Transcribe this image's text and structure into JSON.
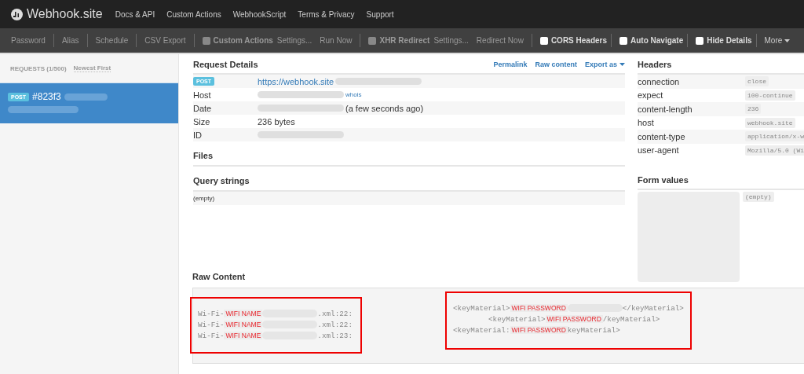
{
  "navbar": {
    "brand": "Webhook.site",
    "links": [
      "Docs & API",
      "Custom Actions",
      "WebhookScript",
      "Terms & Privacy",
      "Support"
    ]
  },
  "toolbar": [
    {
      "kind": "link",
      "label": "Password"
    },
    {
      "kind": "sep"
    },
    {
      "kind": "link",
      "label": "Alias"
    },
    {
      "kind": "sep"
    },
    {
      "kind": "link",
      "label": "Schedule"
    },
    {
      "kind": "sep"
    },
    {
      "kind": "link",
      "label": "CSV Export"
    },
    {
      "kind": "sep"
    },
    {
      "kind": "check",
      "label": "Custom Actions",
      "checked": false,
      "disabled": true
    },
    {
      "kind": "link",
      "label": "Settings..."
    },
    {
      "kind": "link",
      "label": "Run Now"
    },
    {
      "kind": "sep"
    },
    {
      "kind": "check",
      "label": "XHR Redirect",
      "checked": false,
      "disabled": true
    },
    {
      "kind": "link",
      "label": "Settings..."
    },
    {
      "kind": "link",
      "label": "Redirect Now"
    },
    {
      "kind": "sep"
    },
    {
      "kind": "check",
      "label": "CORS Headers",
      "checked": false,
      "disabled": false
    },
    {
      "kind": "sep"
    },
    {
      "kind": "check",
      "label": "Auto Navigate",
      "checked": false,
      "disabled": false
    },
    {
      "kind": "sep"
    },
    {
      "kind": "check",
      "label": "Hide Details",
      "checked": false,
      "disabled": false
    },
    {
      "kind": "sep"
    },
    {
      "kind": "dropdown",
      "label": "More"
    }
  ],
  "sidebar": {
    "title": "REQUESTS (1/500)",
    "sort": "Newest First",
    "requests": [
      {
        "method": "POST",
        "id": "#823f3",
        "selected": true
      }
    ]
  },
  "request_details": {
    "title": "Request Details",
    "actions": [
      {
        "label": "Permalink",
        "kind": "link"
      },
      {
        "label": "Raw content",
        "kind": "link"
      },
      {
        "label": "Export as",
        "kind": "dropdown"
      }
    ],
    "rows": [
      {
        "parts": [
          {
            "kind": "badge",
            "text": "POST"
          }
        ],
        "value": [
          {
            "kind": "link",
            "text": "https://webhook.site"
          },
          {
            "kind": "blur"
          }
        ]
      },
      {
        "parts": [
          {
            "kind": "text",
            "text": "Host"
          }
        ],
        "value": [
          {
            "kind": "blur"
          },
          {
            "kind": "small-link",
            "text": "whois"
          }
        ]
      },
      {
        "parts": [
          {
            "kind": "text",
            "text": "Date"
          }
        ],
        "value": [
          {
            "kind": "blur"
          },
          {
            "kind": "text",
            "text": "(a few seconds ago)"
          }
        ]
      },
      {
        "parts": [
          {
            "kind": "text",
            "text": "Size"
          }
        ],
        "value": [
          {
            "kind": "text",
            "text": "236 bytes"
          }
        ]
      },
      {
        "parts": [
          {
            "kind": "text",
            "text": "ID"
          }
        ],
        "value": [
          {
            "kind": "blur"
          }
        ]
      }
    ]
  },
  "files": {
    "title": "Files"
  },
  "query_strings": {
    "title": "Query strings",
    "value": "(empty)"
  },
  "headers": {
    "title": "Headers",
    "rows": [
      {
        "name": "connection",
        "value": "close"
      },
      {
        "name": "expect",
        "value": "100-continue"
      },
      {
        "name": "content-length",
        "value": "236"
      },
      {
        "name": "host",
        "value": "webhook.site"
      },
      {
        "name": "content-type",
        "value": "application/x-w"
      },
      {
        "name": "user-agent",
        "value": "Mozilla/5.0 (Wi"
      }
    ]
  },
  "form_values": {
    "title": "Form values",
    "value": "(empty)"
  },
  "raw_content": {
    "title": "Raw Content",
    "blocks": [
      {
        "lines": [
          [
            {
              "kind": "text",
              "text": "Wi-Fi-"
            },
            {
              "kind": "label",
              "text": "WIFI NAME"
            },
            {
              "kind": "blur"
            },
            {
              "kind": "text",
              "text": ".xml:22:"
            }
          ],
          [
            {
              "kind": "text",
              "text": "Wi-Fi-"
            },
            {
              "kind": "label",
              "text": "WIFI NAME"
            },
            {
              "kind": "blur"
            },
            {
              "kind": "text",
              "text": ".xml:22:"
            }
          ],
          [
            {
              "kind": "text",
              "text": "Wi-Fi-"
            },
            {
              "kind": "label",
              "text": "WIFI NAME"
            },
            {
              "kind": "blur"
            },
            {
              "kind": "text",
              "text": ".xml:23:"
            }
          ]
        ]
      },
      {
        "lines": [
          [
            {
              "kind": "text",
              "text": "<keyMaterial>"
            },
            {
              "kind": "label",
              "text": "WIFI PASSWORD"
            },
            {
              "kind": "blur"
            },
            {
              "kind": "text",
              "text": "</keyMaterial>"
            }
          ],
          [
            {
              "kind": "indent"
            },
            {
              "kind": "text",
              "text": "<keyMaterial>"
            },
            {
              "kind": "label",
              "text": "WIFI PASSWORD"
            },
            {
              "kind": "text",
              "text": "/keyMaterial>"
            }
          ],
          [
            {
              "kind": "text",
              "text": "<keyMaterial:"
            },
            {
              "kind": "label",
              "text": "WIFI PASSWORD"
            },
            {
              "kind": "text",
              "text": "keyMaterial>"
            }
          ]
        ]
      }
    ]
  }
}
